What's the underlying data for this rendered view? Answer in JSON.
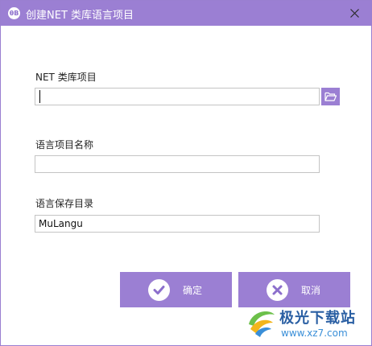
{
  "window": {
    "title": "创建NET 类库语言项目",
    "app_icon_text": "θB",
    "accent_color": "#9b7fd3"
  },
  "form": {
    "net_project": {
      "label": "NET 类库项目",
      "value": "",
      "placeholder": ""
    },
    "language_name": {
      "label": "语言项目名称",
      "value": "",
      "placeholder": ""
    },
    "save_dir": {
      "label": "语言保存目录",
      "value": "MuLangu",
      "placeholder": ""
    }
  },
  "buttons": {
    "ok_label": "确定",
    "cancel_label": "取消"
  },
  "icons": {
    "close": "close-icon",
    "browse": "folder-open-icon",
    "ok": "checkmark-icon",
    "cancel": "cross-icon"
  },
  "watermark": {
    "title": "极光下载站",
    "url": "www.xz7.com"
  }
}
